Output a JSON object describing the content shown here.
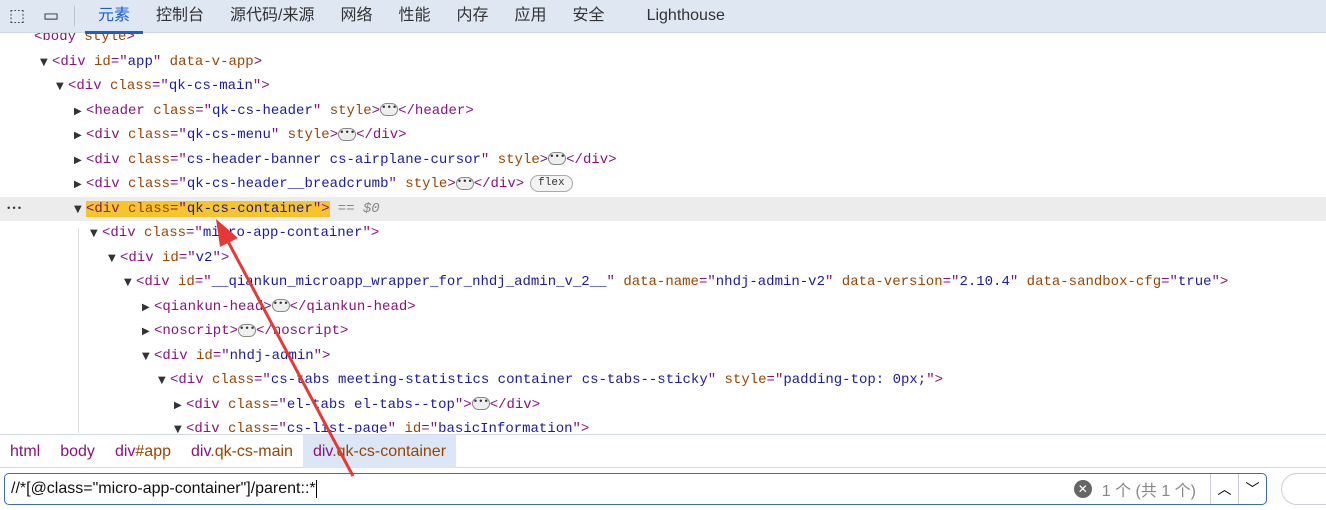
{
  "toolbar": {
    "icons": [
      "inspect-element-icon",
      "device-toolbar-icon"
    ],
    "tabs": [
      {
        "label": "元素",
        "active": true
      },
      {
        "label": "控制台"
      },
      {
        "label": "源代码/来源"
      },
      {
        "label": "网络"
      },
      {
        "label": "性能"
      },
      {
        "label": "内存"
      },
      {
        "label": "应用"
      },
      {
        "label": "安全"
      },
      {
        "label": "Lighthouse"
      }
    ]
  },
  "tree": [
    {
      "depth": 0,
      "arrow": "",
      "tokens": [
        [
          "tag",
          "<body "
        ],
        [
          "attr",
          "style"
        ],
        [
          "tag",
          ">"
        ]
      ]
    },
    {
      "depth": 1,
      "arrow": "▼",
      "tokens": [
        [
          "tag",
          "<div "
        ],
        [
          "attr",
          "id"
        ],
        [
          "tag",
          "=\""
        ],
        [
          "val",
          "app"
        ],
        [
          "tag",
          "\" "
        ],
        [
          "attr",
          "data-v-app"
        ],
        [
          "tag",
          ">"
        ]
      ]
    },
    {
      "depth": 2,
      "arrow": "▼",
      "tokens": [
        [
          "tag",
          "<div "
        ],
        [
          "attr",
          "class"
        ],
        [
          "tag",
          "=\""
        ],
        [
          "val",
          "qk-cs-main"
        ],
        [
          "tag",
          "\">"
        ]
      ]
    },
    {
      "depth": 3,
      "arrow": "▶",
      "tokens": [
        [
          "tag",
          "<header "
        ],
        [
          "attr",
          "class"
        ],
        [
          "tag",
          "=\""
        ],
        [
          "val",
          "qk-cs-header"
        ],
        [
          "tag",
          "\" "
        ],
        [
          "attr",
          "style"
        ],
        [
          "tag",
          ">"
        ],
        [
          "ell",
          "…"
        ],
        [
          "tag",
          "</header>"
        ]
      ]
    },
    {
      "depth": 3,
      "arrow": "▶",
      "tokens": [
        [
          "tag",
          "<div "
        ],
        [
          "attr",
          "class"
        ],
        [
          "tag",
          "=\""
        ],
        [
          "val",
          "qk-cs-menu"
        ],
        [
          "tag",
          "\" "
        ],
        [
          "attr",
          "style"
        ],
        [
          "tag",
          ">"
        ],
        [
          "ell",
          "…"
        ],
        [
          "tag",
          "</div>"
        ]
      ]
    },
    {
      "depth": 3,
      "arrow": "▶",
      "tokens": [
        [
          "tag",
          "<div "
        ],
        [
          "attr",
          "class"
        ],
        [
          "tag",
          "=\""
        ],
        [
          "val",
          "cs-header-banner cs-airplane-cursor"
        ],
        [
          "tag",
          "\" "
        ],
        [
          "attr",
          "style"
        ],
        [
          "tag",
          ">"
        ],
        [
          "ell",
          "…"
        ],
        [
          "tag",
          "</div>"
        ]
      ]
    },
    {
      "depth": 3,
      "arrow": "▶",
      "tokens": [
        [
          "tag",
          "<div "
        ],
        [
          "attr",
          "class"
        ],
        [
          "tag",
          "=\""
        ],
        [
          "val",
          "qk-cs-header__breadcrumb"
        ],
        [
          "tag",
          "\" "
        ],
        [
          "attr",
          "style"
        ],
        [
          "tag",
          ">"
        ],
        [
          "ell",
          "…"
        ],
        [
          "tag",
          "</div>"
        ],
        [
          "badge",
          "flex"
        ]
      ]
    },
    {
      "depth": 3,
      "arrow": "▼",
      "selected": true,
      "tokens": [
        [
          "tag",
          "<div "
        ],
        [
          "attr",
          "class"
        ],
        [
          "tag",
          "=\""
        ],
        [
          "val",
          "qk-cs-container"
        ],
        [
          "tag",
          "\">"
        ]
      ],
      "eq": "== $0"
    },
    {
      "depth": 4,
      "arrow": "▼",
      "tokens": [
        [
          "tag",
          "<div "
        ],
        [
          "attr",
          "class"
        ],
        [
          "tag",
          "=\""
        ],
        [
          "val",
          "micro-app-container"
        ],
        [
          "tag",
          "\">"
        ]
      ]
    },
    {
      "depth": 5,
      "arrow": "▼",
      "tokens": [
        [
          "tag",
          "<div "
        ],
        [
          "attr",
          "id"
        ],
        [
          "tag",
          "=\""
        ],
        [
          "val",
          "v2"
        ],
        [
          "tag",
          "\">"
        ]
      ]
    },
    {
      "depth": 6,
      "arrow": "▼",
      "tokens": [
        [
          "tag",
          "<div "
        ],
        [
          "attr",
          "id"
        ],
        [
          "tag",
          "=\""
        ],
        [
          "val",
          "__qiankun_microapp_wrapper_for_nhdj_admin_v_2__"
        ],
        [
          "tag",
          "\" "
        ],
        [
          "attr",
          "data-name"
        ],
        [
          "tag",
          "=\""
        ],
        [
          "val",
          "nhdj-admin-v2"
        ],
        [
          "tag",
          "\" "
        ],
        [
          "attr",
          "data-version"
        ],
        [
          "tag",
          "=\""
        ],
        [
          "val",
          "2.10.4"
        ],
        [
          "tag",
          "\" "
        ],
        [
          "attr",
          "data-sandbox-cfg"
        ],
        [
          "tag",
          "=\""
        ],
        [
          "val",
          "true"
        ],
        [
          "tag",
          "\">"
        ]
      ]
    },
    {
      "depth": 7,
      "arrow": "▶",
      "tokens": [
        [
          "tag",
          "<qiankun-head>"
        ],
        [
          "ell",
          "…"
        ],
        [
          "tag",
          "</qiankun-head>"
        ]
      ]
    },
    {
      "depth": 7,
      "arrow": "▶",
      "tokens": [
        [
          "tag",
          "<noscript>"
        ],
        [
          "ell",
          "…"
        ],
        [
          "tag",
          "</noscript>"
        ]
      ]
    },
    {
      "depth": 7,
      "arrow": "▼",
      "tokens": [
        [
          "tag",
          "<div "
        ],
        [
          "attr",
          "id"
        ],
        [
          "tag",
          "=\""
        ],
        [
          "val",
          "nhdj-admin"
        ],
        [
          "tag",
          "\">"
        ]
      ]
    },
    {
      "depth": 8,
      "arrow": "▼",
      "tokens": [
        [
          "tag",
          "<div "
        ],
        [
          "attr",
          "class"
        ],
        [
          "tag",
          "=\""
        ],
        [
          "val",
          "cs-tabs meeting-statistics container cs-tabs--sticky"
        ],
        [
          "tag",
          "\" "
        ],
        [
          "attr",
          "style"
        ],
        [
          "tag",
          "=\""
        ],
        [
          "val",
          "padding-top: 0px;"
        ],
        [
          "tag",
          "\">"
        ]
      ]
    },
    {
      "depth": 9,
      "arrow": "▶",
      "tokens": [
        [
          "tag",
          "<div "
        ],
        [
          "attr",
          "class"
        ],
        [
          "tag",
          "=\""
        ],
        [
          "val",
          "el-tabs el-tabs--top"
        ],
        [
          "tag",
          "\">"
        ],
        [
          "ell",
          "…"
        ],
        [
          "tag",
          "</div>"
        ]
      ]
    },
    {
      "depth": 9,
      "arrow": "▼",
      "tokens": [
        [
          "tag",
          "<div "
        ],
        [
          "attr",
          "class"
        ],
        [
          "tag",
          "=\""
        ],
        [
          "val",
          "cs-list-page"
        ],
        [
          "tag",
          "\" "
        ],
        [
          "attr",
          "id"
        ],
        [
          "tag",
          "=\""
        ],
        [
          "val",
          "basicInformation"
        ],
        [
          "tag",
          "\">"
        ]
      ]
    }
  ],
  "breadcrumb": [
    {
      "tag": "html"
    },
    {
      "tag": "body"
    },
    {
      "tag": "div",
      "suffix": "#app"
    },
    {
      "tag": "div",
      "suffix": ".qk-cs-main"
    },
    {
      "tag": "div",
      "suffix": ".qk-cs-container",
      "selected": true
    }
  ],
  "search": {
    "value": "//*[@class=\"micro-app-container\"]/parent::*",
    "count": "1 个 (共 1 个)",
    "prev_icon": "chevron-up-icon",
    "next_icon": "chevron-down-icon"
  },
  "annotation": {
    "color": "#e53935",
    "type": "arrow"
  }
}
